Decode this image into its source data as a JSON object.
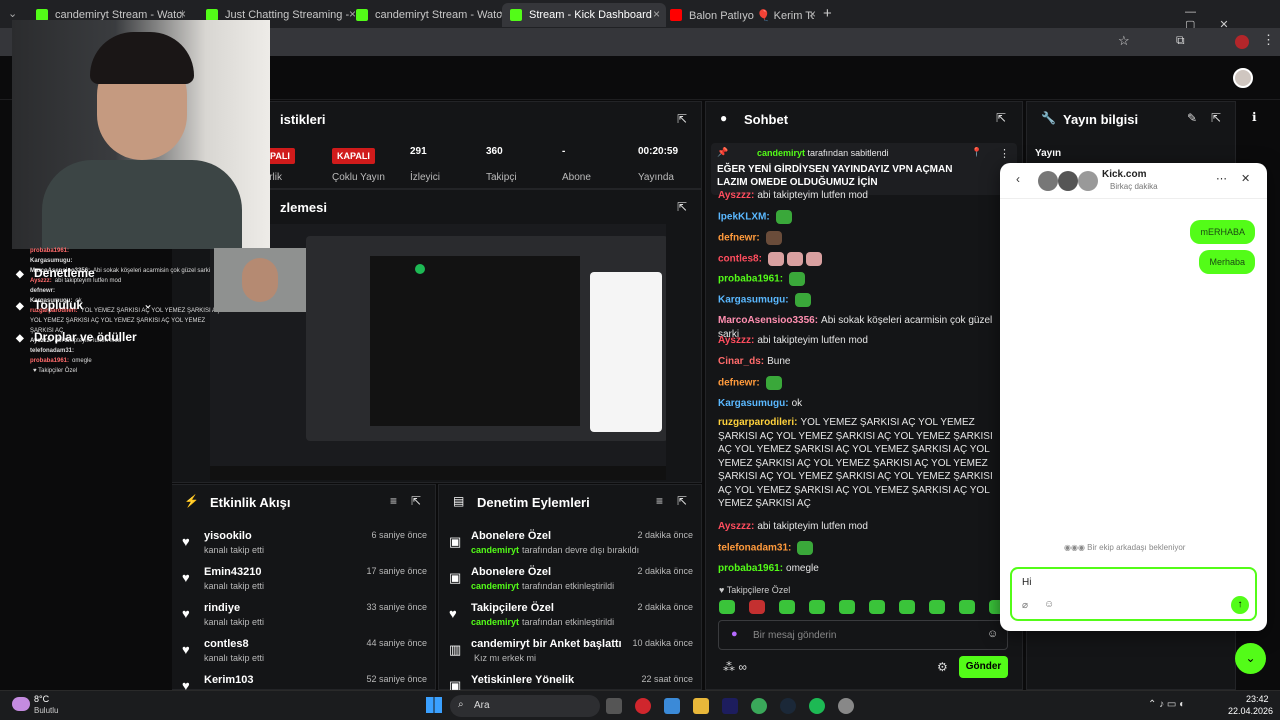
{
  "browser": {
    "tabs": [
      {
        "label": "candemiryt Stream - Watch Liv",
        "icon": "kick-favicon"
      },
      {
        "label": "Just Chatting Streaming - Live S",
        "icon": "kick-favicon"
      },
      {
        "label": "candemiryt Stream - Watch Liv",
        "icon": "kick-favicon"
      },
      {
        "label": "Stream - Kick Dashboard",
        "icon": "kick-favicon",
        "active": true
      },
      {
        "label": "Balon Patlıyo 🎈 Kerim Token k",
        "icon": "youtube-favicon"
      }
    ],
    "new_tab": "+"
  },
  "sidebar": {
    "items": [
      {
        "label": "Denetleme",
        "icon": "wrench-icon"
      },
      {
        "label": "Topluluk",
        "icon": "users-icon"
      },
      {
        "label": "Droplar ve ödüller",
        "icon": "gift-icon"
      }
    ]
  },
  "webcam_overlay_chat": [
    {
      "user": "probaba1961:",
      "text": ""
    },
    {
      "user": "Kargasumugu:",
      "text": ""
    },
    {
      "user": "MarcoAsensioo3356:",
      "text": "Abi sokak köşeleri acarmisin çok güzel sarki"
    },
    {
      "user": "Ayszzz:",
      "text": "abi takipteyim lutfen mod"
    },
    {
      "user": "defnewr:",
      "text": ""
    },
    {
      "user": "Kargasumugu:",
      "text": "ok"
    },
    {
      "user": "ruzgarparodileri:",
      "text": "YOL YEMEZ ŞARKISI AÇ YOL YEMEZ ŞARKISI AÇ YOL YEMEZ ŞARKISI AÇ YOL YEMEZ ŞARKISI AÇ YOL YEMEZ ŞARKISI AÇ"
    },
    {
      "user": "Ayszzz:",
      "text": "abi takipteyim lutfen mod"
    },
    {
      "user": "telefonadam31:",
      "text": ""
    },
    {
      "user": "probaba1961:",
      "text": "omegle"
    },
    {
      "user": "",
      "text": "♥ Takipçiler Özel"
    }
  ],
  "stats": {
    "title": "istikleri",
    "items": [
      {
        "value": "KAPALI",
        "label": "rtnerlik",
        "badge": true
      },
      {
        "value": "KAPALI",
        "label": "Çoklu Yayın",
        "badge": true
      },
      {
        "value": "291",
        "label": "İzleyici"
      },
      {
        "value": "360",
        "label": "Takipçi"
      },
      {
        "value": "-",
        "label": "Abone"
      },
      {
        "value": "00:20:59",
        "label": "Yayında"
      }
    ]
  },
  "preview": {
    "title": "zlemesi"
  },
  "activity": {
    "title": "Etkinlik Akışı",
    "rows": [
      {
        "name": "yisookilo",
        "sub": "kanalı takip etti",
        "time": "6 saniye önce"
      },
      {
        "name": "Emin43210",
        "sub": "kanalı takip etti",
        "time": "17 saniye önce"
      },
      {
        "name": "rindiye",
        "sub": "kanalı takip etti",
        "time": "33 saniye önce"
      },
      {
        "name": "contles8",
        "sub": "kanalı takip etti",
        "time": "44 saniye önce"
      },
      {
        "name": "Kerim103",
        "sub": "",
        "time": "52 saniye önce"
      }
    ]
  },
  "moderation": {
    "title": "Denetim Eylemleri",
    "rows": [
      {
        "name": "Abonelere Özel",
        "actor": "candemiryt",
        "sub": "tarafından devre dışı bırakıldı",
        "time": "2 dakika önce",
        "icon": "gift-icon"
      },
      {
        "name": "Abonelere Özel",
        "actor": "candemiryt",
        "sub": "tarafından etkinleştirildi",
        "time": "2 dakika önce",
        "icon": "gift-icon"
      },
      {
        "name": "Takipçilere Özel",
        "actor": "candemiryt",
        "sub": "tarafından etkinleştirildi",
        "time": "2 dakika önce",
        "icon": "heart-icon"
      },
      {
        "name": "candemiryt bir Anket başlattı",
        "actor": "",
        "sub": "Kız mı erkek mi",
        "time": "10 dakika önce",
        "icon": "poll-icon"
      },
      {
        "name": "Yetiskinlere Yönelik",
        "actor": "",
        "sub": "",
        "time": "22 saat önce",
        "icon": "gift-icon"
      }
    ]
  },
  "chat": {
    "title": "Sohbet",
    "pinned_user": "candemiryt",
    "pinned_by": "tarafından sabitlendi",
    "pinned_text": "EĞER YENİ GİRDİYSEN YAYINDAYIZ VPN AÇMAN LAZIM OMEDE OLDUĞUMUZ İÇİN",
    "messages": [
      {
        "user": "Ayszzz:",
        "text": "abi takipteyim lutfen mod",
        "color": "#ff4d5e"
      },
      {
        "user": "IpekKLXM:",
        "text": "",
        "color": "#5ab8ff"
      },
      {
        "user": "defnewr:",
        "text": "",
        "color": "#ff9a3c"
      },
      {
        "user": "contles8:",
        "text": "",
        "color": "#ff4d5e"
      },
      {
        "user": "probaba1961:",
        "text": "",
        "color": "#53fc18"
      },
      {
        "user": "Kargasumugu:",
        "text": "",
        "color": "#5ab8ff"
      },
      {
        "user": "MarcoAsensioo3356:",
        "text": "Abi sokak köşeleri acarmisin çok güzel sarki",
        "color": "#ff8fb0"
      },
      {
        "user": "Ayszzz:",
        "text": "abi takipteyim lutfen mod",
        "color": "#ff4d5e"
      },
      {
        "user": "Cinar_ds:",
        "text": "Bune",
        "color": "#ff6b6b"
      },
      {
        "user": "defnewr:",
        "text": "",
        "color": "#ff9a3c"
      },
      {
        "user": "Kargasumugu:",
        "text": "ok",
        "color": "#5ab8ff"
      },
      {
        "user": "ruzgarparodileri:",
        "text": "YOL YEMEZ ŞARKISI AÇ YOL YEMEZ ŞARKISI AÇ YOL YEMEZ ŞARKISI AÇ YOL YEMEZ ŞARKISI AÇ YOL YEMEZ ŞARKISI AÇ YOL YEMEZ ŞARKISI AÇ YOL YEMEZ ŞARKISI AÇ YOL YEMEZ ŞARKISI AÇ YOL YEMEZ ŞARKISI AÇ YOL YEMEZ ŞARKISI AÇ YOL YEMEZ ŞARKISI AÇ YOL YEMEZ ŞARKISI AÇ YOL YEMEZ ŞARKISI AÇ YOL YEMEZ ŞARKISI AÇ",
        "color": "#ffd23c"
      },
      {
        "user": "Ayszzz:",
        "text": "abi takipteyim lutfen mod",
        "color": "#ff4d5e"
      },
      {
        "user": "telefonadam31:",
        "text": "",
        "color": "#ff9a3c"
      },
      {
        "user": "probaba1961:",
        "text": "omegle",
        "color": "#53fc18"
      }
    ],
    "followers_only": "Takipçilere Özel",
    "input_placeholder": "Bir mesaj gönderin",
    "send_label": "Gönder"
  },
  "stream_info": {
    "title": "Yayın bilgisi",
    "field": "Yayın"
  },
  "dm_popup": {
    "name": "Kick.com",
    "status": "Birkaç dakika",
    "messages": [
      "mERHABA",
      "Merhaba"
    ],
    "waiting": "Bir ekip arkadaşı bekleniyor",
    "input_value": "Hi"
  },
  "taskbar": {
    "weather_temp": "8°C",
    "weather_desc": "Bulutlu",
    "search": "Ara",
    "time": "23:42",
    "date": "22.04.2026"
  },
  "colors": {
    "accent": "#53fc18",
    "badge": "#d01b1b"
  }
}
